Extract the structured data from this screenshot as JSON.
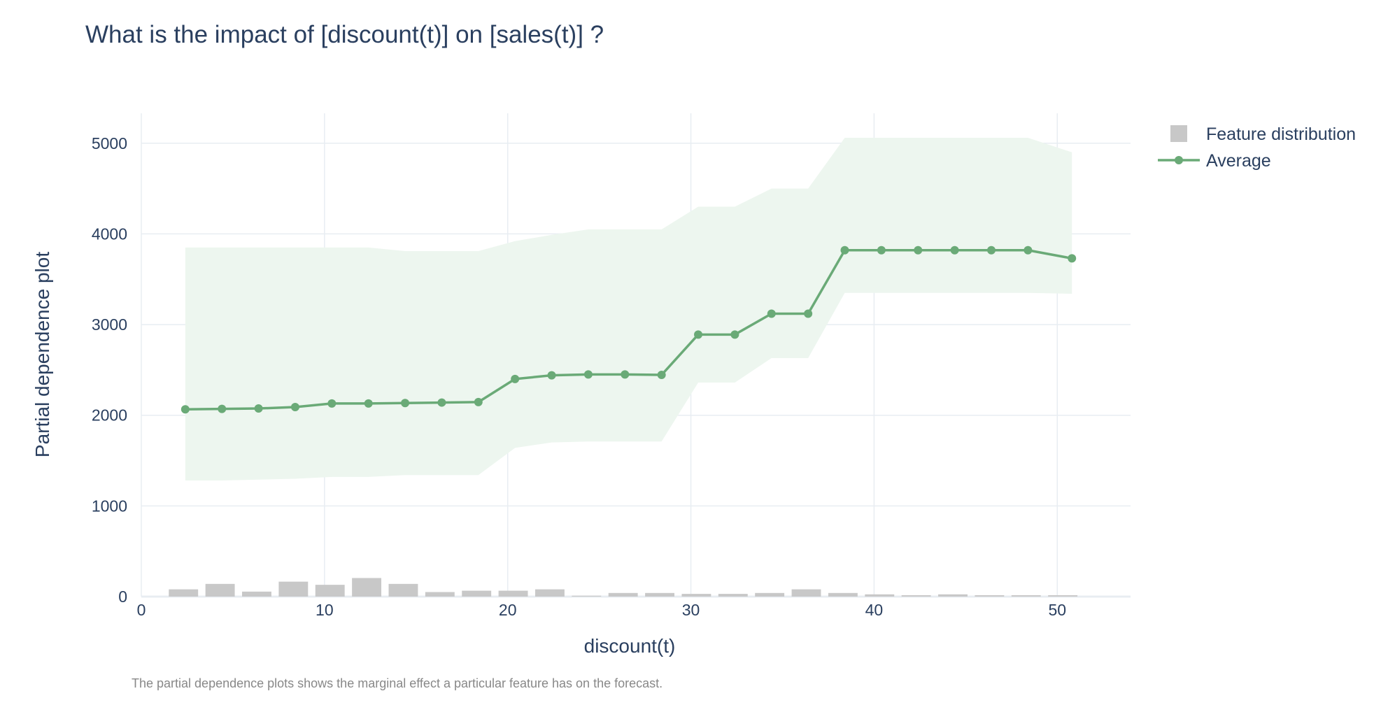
{
  "chart_data": {
    "type": "line",
    "title": "What is the impact of [discount(t)] on [sales(t)] ?",
    "xlabel": "discount(t)",
    "ylabel": "Partial dependence plot",
    "xlim": [
      0,
      54
    ],
    "ylim": [
      0,
      5330
    ],
    "x_ticks": [
      0,
      10,
      20,
      30,
      40,
      50
    ],
    "y_ticks": [
      0,
      1000,
      2000,
      3000,
      4000,
      5000
    ],
    "grid": true,
    "legend_position": "top-right",
    "footnote": "The partial dependence plots shows the marginal effect a particular feature has on the forecast.",
    "series": [
      {
        "name": "Average",
        "kind": "line+markers",
        "color": "#6aaa77",
        "x": [
          2.4,
          4.4,
          6.4,
          8.4,
          10.4,
          12.4,
          14.4,
          16.4,
          18.4,
          20.4,
          22.4,
          24.4,
          26.4,
          28.4,
          30.4,
          32.4,
          34.4,
          36.4,
          38.4,
          40.4,
          42.4,
          44.4,
          46.4,
          48.4,
          50.8
        ],
        "y": [
          2065,
          2070,
          2075,
          2090,
          2130,
          2130,
          2135,
          2140,
          2145,
          2400,
          2440,
          2450,
          2450,
          2445,
          2890,
          2890,
          3120,
          3120,
          3820,
          3820,
          3820,
          3820,
          3820,
          3820,
          3730
        ]
      },
      {
        "name": "",
        "kind": "band",
        "color": "#edf6ef",
        "x": [
          2.4,
          4.4,
          6.4,
          8.4,
          10.4,
          12.4,
          14.4,
          16.4,
          18.4,
          20.4,
          22.4,
          24.4,
          26.4,
          28.4,
          30.4,
          32.4,
          34.4,
          36.4,
          38.4,
          40.4,
          42.4,
          44.4,
          46.4,
          48.4,
          50.8
        ],
        "upper": [
          3850,
          3850,
          3850,
          3850,
          3850,
          3850,
          3810,
          3810,
          3810,
          3920,
          3990,
          4050,
          4050,
          4050,
          4300,
          4300,
          4500,
          4500,
          5060,
          5060,
          5060,
          5060,
          5060,
          5060,
          4900
        ],
        "lower": [
          1280,
          1280,
          1290,
          1300,
          1320,
          1320,
          1340,
          1340,
          1340,
          1640,
          1700,
          1710,
          1710,
          1710,
          2360,
          2360,
          2630,
          2630,
          3350,
          3350,
          3350,
          3350,
          3350,
          3350,
          3340
        ]
      },
      {
        "name": "Feature distribution",
        "kind": "bar",
        "color": "#c8c8c8",
        "x": [
          2.3,
          4.3,
          6.3,
          8.3,
          10.3,
          12.3,
          14.3,
          16.3,
          18.3,
          20.3,
          22.3,
          24.3,
          26.3,
          28.3,
          30.3,
          32.3,
          34.3,
          36.3,
          38.3,
          40.3,
          42.3,
          44.3,
          46.3,
          48.3,
          50.3
        ],
        "values": [
          80,
          140,
          55,
          165,
          130,
          205,
          140,
          50,
          65,
          65,
          80,
          10,
          40,
          40,
          30,
          30,
          40,
          80,
          40,
          25,
          15,
          25,
          15,
          15,
          15
        ]
      }
    ]
  },
  "legend": {
    "items": [
      {
        "label": "Feature distribution",
        "color": "#c8c8c8"
      },
      {
        "label": "Average",
        "color": "#6aaa77"
      }
    ]
  }
}
